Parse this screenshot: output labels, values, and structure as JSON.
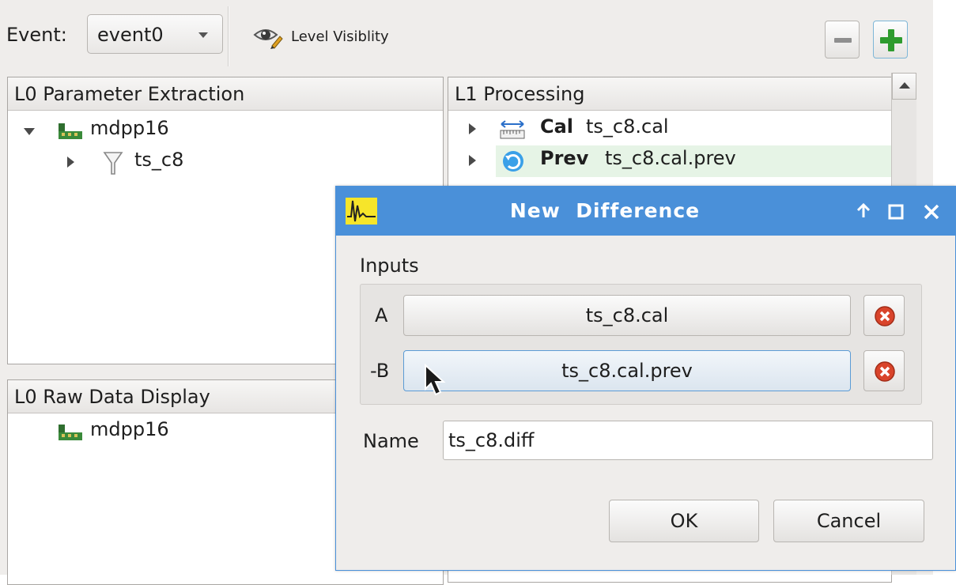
{
  "toolbar": {
    "event_label": "Event:",
    "event_value": "event0",
    "level_visibility_label": "Level Visiblity",
    "icons": {
      "level_visibility": "eye-pencil-icon",
      "remove": "minus-icon",
      "add": "plus-icon"
    },
    "add_icon_color": "#2e9b2e"
  },
  "panels": {
    "l0_param": {
      "title": "L0 Parameter Extraction",
      "items": [
        {
          "label": "mdpp16",
          "icon": "module-board-icon",
          "expanded": true
        },
        {
          "label": "ts_c8",
          "icon": "filter-funnel-icon",
          "expanded": false
        }
      ]
    },
    "l0_raw": {
      "title": "L0 Raw Data Display",
      "items": [
        {
          "label": "mdpp16",
          "icon": "module-board-icon"
        }
      ]
    },
    "l1": {
      "title": "L1 Processing",
      "items": [
        {
          "kind": "Cal",
          "label": "ts_c8.cal",
          "icon": "calibration-ruler-icon"
        },
        {
          "kind": "Prev",
          "label": "ts_c8.cal.prev",
          "icon": "previous-value-icon",
          "highlighted": true
        }
      ]
    }
  },
  "dialog": {
    "title": "New  Difference",
    "title_icon": "waveform-icon",
    "controls": {
      "up": "arrow-up-icon",
      "maximize": "maximize-icon",
      "close": "close-icon"
    },
    "inputs_label": "Inputs",
    "input_a": {
      "label": "A",
      "value": "ts_c8.cal"
    },
    "input_b": {
      "label": "-B",
      "value": "ts_c8.cal.prev"
    },
    "name_label": "Name",
    "name_value": "ts_c8.diff",
    "ok_label": "OK",
    "cancel_label": "Cancel",
    "accent_color": "#4a90d9"
  }
}
